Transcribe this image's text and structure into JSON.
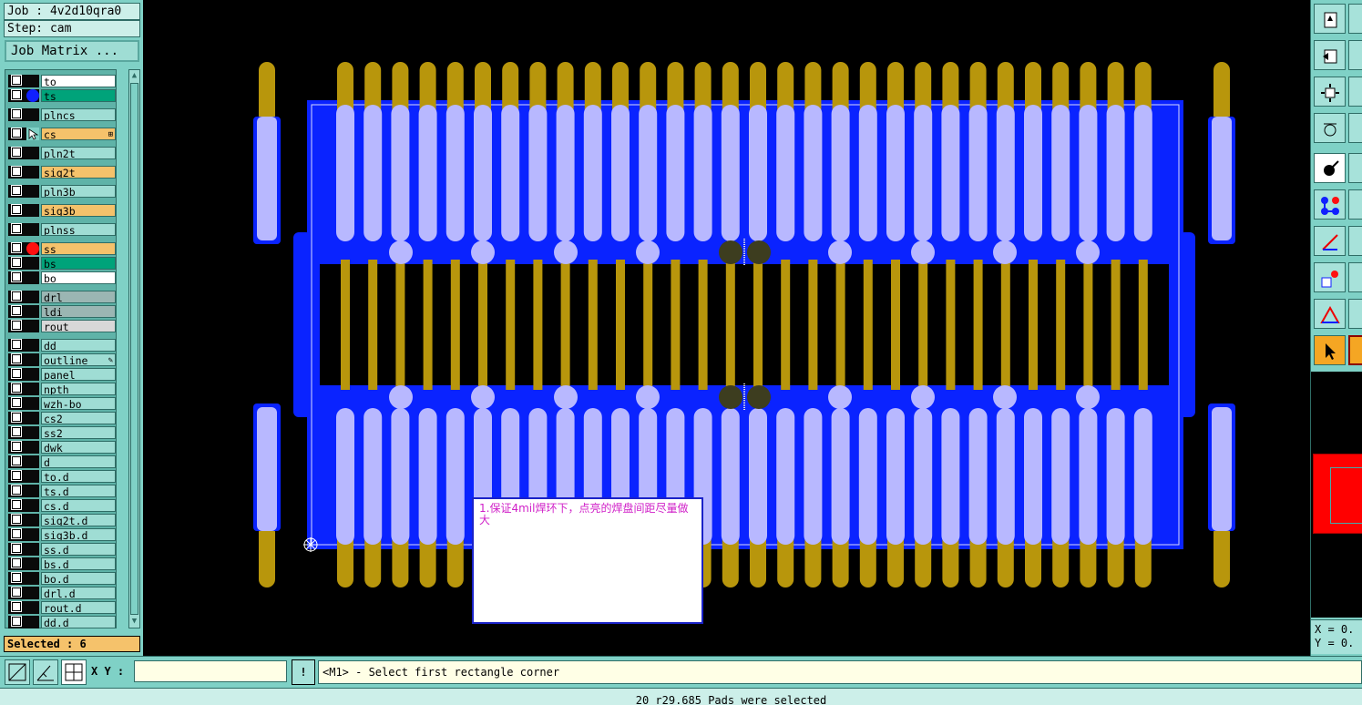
{
  "header": {
    "job_label": "Job : 4v2d10qra0",
    "step_label": "Step: cam",
    "job_matrix_button": "Job Matrix ..."
  },
  "layers": [
    {
      "name": "to",
      "color": "#ffffff"
    },
    {
      "name": "ts",
      "color": "#00a37a",
      "dot": "#1020ff"
    },
    {
      "name": "plncs",
      "color": "#9fddd4"
    },
    {
      "name": "cs",
      "color": "#f5c26b",
      "icon": "pointer-icon",
      "marker": "⊞"
    },
    {
      "name": "pln2t",
      "color": "#9fddd4"
    },
    {
      "name": "sig2t",
      "color": "#f5c26b"
    },
    {
      "name": "pln3b",
      "color": "#9fddd4"
    },
    {
      "name": "sig3b",
      "color": "#f5c26b"
    },
    {
      "name": "plnss",
      "color": "#9fddd4"
    },
    {
      "name": "ss",
      "color": "#f5c26b",
      "dot": "#ff1010"
    },
    {
      "name": "bs",
      "color": "#00a37a"
    },
    {
      "name": "bo",
      "color": "#ffffff"
    },
    {
      "name": "drl",
      "color": "#9bb6b3"
    },
    {
      "name": "ldi",
      "color": "#9bb6b3"
    },
    {
      "name": "rout",
      "color": "#d8d8d8"
    },
    {
      "name": "dd",
      "color": "#9fddd4"
    },
    {
      "name": "outline",
      "color": "#9fddd4",
      "marker": "✎"
    },
    {
      "name": "panel",
      "color": "#9fddd4"
    },
    {
      "name": "npth",
      "color": "#9fddd4"
    },
    {
      "name": "wzh-bo",
      "color": "#9fddd4"
    },
    {
      "name": "cs2",
      "color": "#9fddd4"
    },
    {
      "name": "ss2",
      "color": "#9fddd4"
    },
    {
      "name": "dwk",
      "color": "#9fddd4"
    },
    {
      "name": "d",
      "color": "#9fddd4"
    },
    {
      "name": "to.d",
      "color": "#9fddd4"
    },
    {
      "name": "ts.d",
      "color": "#9fddd4"
    },
    {
      "name": "cs.d",
      "color": "#9fddd4"
    },
    {
      "name": "sig2t.d",
      "color": "#9fddd4"
    },
    {
      "name": "sig3b.d",
      "color": "#9fddd4"
    },
    {
      "name": "ss.d",
      "color": "#9fddd4"
    },
    {
      "name": "bs.d",
      "color": "#9fddd4"
    },
    {
      "name": "bo.d",
      "color": "#9fddd4"
    },
    {
      "name": "drl.d",
      "color": "#9fddd4"
    },
    {
      "name": "rout.d",
      "color": "#9fddd4"
    },
    {
      "name": "dd.d",
      "color": "#9fddd4"
    }
  ],
  "selected_label": "Selected : 6",
  "note_text": "1.保证4mil焊环下，点亮的焊盘间距尽量做大",
  "coords": {
    "x_label": "X = 0.",
    "y_label": "Y = 0."
  },
  "command": {
    "xy_label": "X Y :",
    "xy_value": "",
    "excl_label": "!",
    "prompt": "<M1> - Select first rectangle corner"
  },
  "status_text": "20 r29.685 Pads were selected",
  "colors": {
    "canvas_bg": "#000000",
    "copper_blue": "#0a23ff",
    "pad_lilac": "#b8b8ff",
    "finger_gold": "#b8960c",
    "selected_pad": "#3d3d1f"
  },
  "right_tools": [
    "layer-in-icon",
    "layer-out-icon",
    "zoom-fit-icon",
    "gear-sketch-icon",
    "pad-select-icon",
    "net-icon",
    "line-icon",
    "pad-add-icon",
    "triangle-icon",
    "pointer-icon"
  ]
}
